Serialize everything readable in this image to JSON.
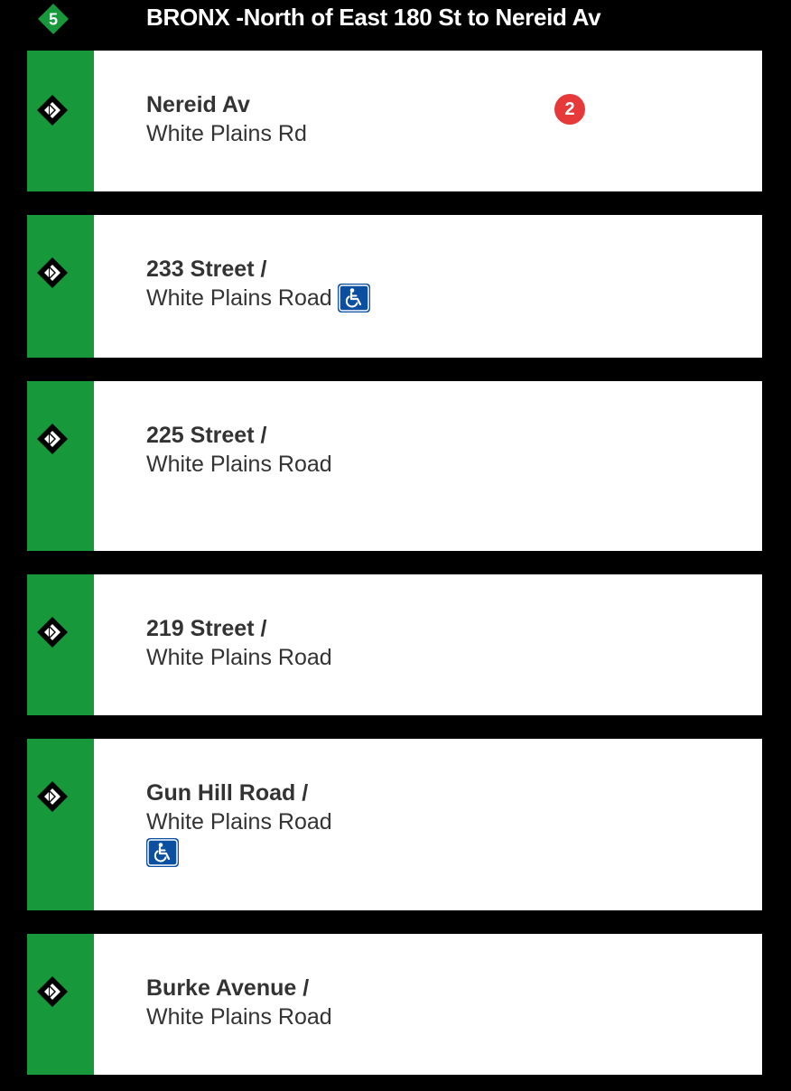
{
  "header": {
    "route": "5",
    "route_color": "#17993b",
    "title": "BRONX -North of East 180 St to Nereid Av"
  },
  "colors": {
    "line_stripe": "#17993b",
    "alert": "#e63a3a",
    "accessible_icon_bg": "#0a4fa0"
  },
  "stations": [
    {
      "name": "Nereid Av",
      "sub": "White Plains Rd",
      "alert_count": "2",
      "accessible": false,
      "icon": "stop-marker-icon"
    },
    {
      "name": "233 Street /",
      "sub": "White Plains Road",
      "accessible": true,
      "icon": "stop-marker-icon"
    },
    {
      "name": "225 Street /",
      "sub": "White Plains Road",
      "accessible": false,
      "icon": "stop-marker-icon"
    },
    {
      "name": "219 Street /",
      "sub": "White Plains Road",
      "accessible": false,
      "icon": "stop-marker-icon"
    },
    {
      "name": "Gun Hill Road /",
      "sub": "White Plains Road",
      "accessible": true,
      "icon": "stop-marker-icon"
    },
    {
      "name": "Burke Avenue /",
      "sub": "White Plains Road",
      "accessible": false,
      "icon": "stop-marker-icon"
    }
  ]
}
